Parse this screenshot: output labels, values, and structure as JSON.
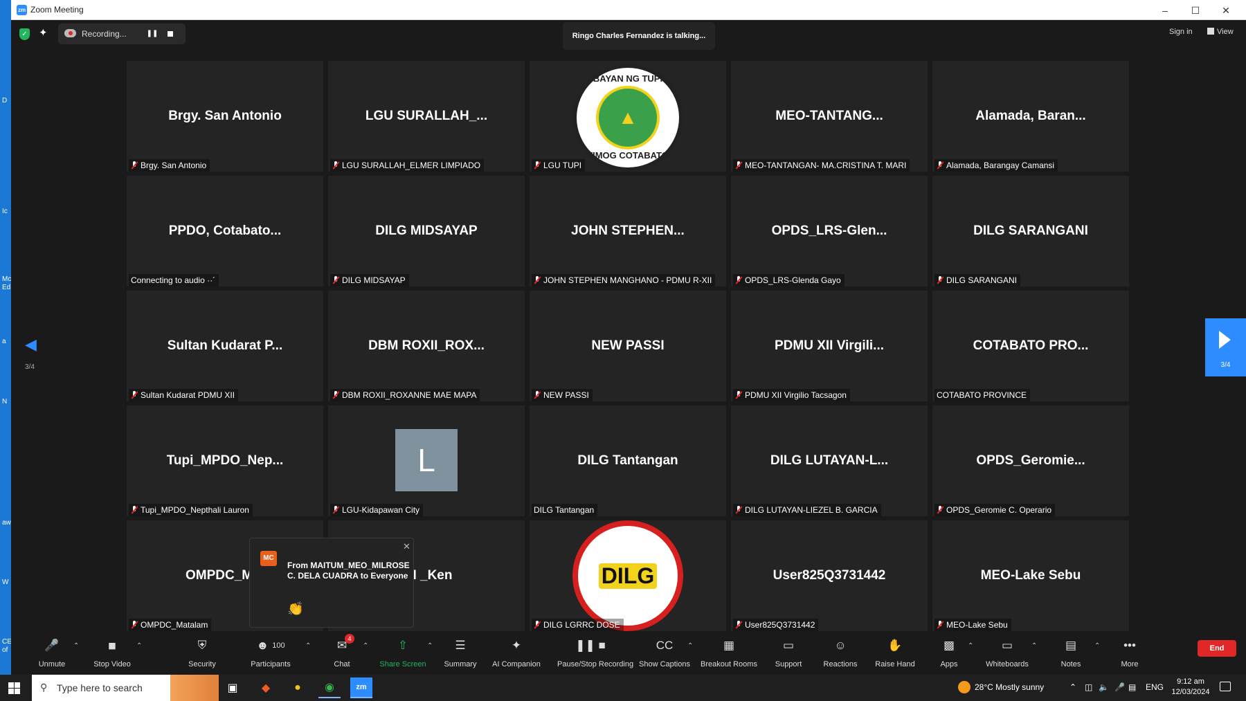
{
  "window": {
    "title": "Zoom Meeting",
    "icon": "zm"
  },
  "desktop_strip": [
    "D",
    "Ic",
    "Mc",
    "Ed",
    "a",
    "N",
    "aw",
    "W",
    "CE",
    "of"
  ],
  "topbar": {
    "recording_label": "Recording...",
    "talking": "Ringo Charles Fernandez is talking...",
    "sign_in": "Sign in",
    "view": "View"
  },
  "nav": {
    "left_page": "3/4",
    "right_page": "3/4"
  },
  "tiles": [
    {
      "big": "Brgy. San Antonio",
      "label": "Brgy. San Antonio",
      "muted": true
    },
    {
      "big": "LGU  SURALLAH_...",
      "label": "LGU SURALLAH_ELMER LIMPIADO",
      "muted": true
    },
    {
      "big": "",
      "label": "LGU TUPI",
      "muted": true,
      "logo": "tupi",
      "logo_top": "BAYAN NG TUPI",
      "logo_bottom": "TIMOG COTABATO"
    },
    {
      "big": "MEO-TANTANG...",
      "label": "MEO-TANTANGAN- MA.CRISTINA T. MARI",
      "muted": true
    },
    {
      "big": "Alamada,  Baran...",
      "label": "Alamada, Barangay Camansi",
      "muted": true
    },
    {
      "big": "PPDO,  Cotabato...",
      "label": "Connecting to audio ··´",
      "muted": false
    },
    {
      "big": "DILG MIDSAYAP",
      "label": "DILG MIDSAYAP",
      "muted": true
    },
    {
      "big": "JOHN  STEPHEN...",
      "label": "JOHN STEPHEN MANGHANO - PDMU  R-XII",
      "muted": true
    },
    {
      "big": "OPDS_LRS-Glen...",
      "label": "OPDS_LRS-Glenda Gayo",
      "muted": true
    },
    {
      "big": "DILG SARANGANI",
      "label": "DILG SARANGANI",
      "muted": true
    },
    {
      "big": "Sultan Kudarat P...",
      "label": "Sultan Kudarat PDMU XII",
      "muted": true
    },
    {
      "big": "DBM  ROXII_ROX...",
      "label": "DBM ROXII_ROXANNE MAE MAPA",
      "muted": true
    },
    {
      "big": "NEW PASSI",
      "label": "NEW PASSI",
      "muted": true
    },
    {
      "big": "PDMU XII Virgili...",
      "label": "PDMU XII Virgilio Tacsagon",
      "muted": true
    },
    {
      "big": "COTABATO  PRO...",
      "label": "COTABATO PROVINCE",
      "muted": false
    },
    {
      "big": "Tupi_MPDO_Nep...",
      "label": "Tupi_MPDO_Nepthali Lauron",
      "muted": true
    },
    {
      "big": "",
      "label": "LGU-Kidapawan City",
      "muted": true,
      "avatar": "L"
    },
    {
      "big": "DILG Tantangan",
      "label": "DILG Tantangan",
      "muted": false
    },
    {
      "big": "DILG  LUTAYAN-L...",
      "label": "DILG LUTAYAN-LIEZEL B. GARCIA",
      "muted": true
    },
    {
      "big": "OPDS_Geromie...",
      "label": "OPDS_Geromie C. Operario",
      "muted": true
    },
    {
      "big": "OMPDC_Mat",
      "label": "OMPDC_Matalam",
      "muted": true
    },
    {
      "big": "XII _Ken",
      "label": "",
      "muted": false
    },
    {
      "big": "",
      "label": "DILG LGRRC DOSE",
      "muted": true,
      "logo": "dilg",
      "logo_word": "DILG"
    },
    {
      "big": "User825Q3731442",
      "label": "User825Q3731442",
      "muted": true
    },
    {
      "big": "MEO-Lake Sebu",
      "label": "MEO-Lake Sebu",
      "muted": true
    }
  ],
  "chat_popup": {
    "initials": "MC",
    "from": "From MAITUM_MEO_MILROSE C. DELA CUADRA to Everyone",
    "close": "✕",
    "emoji": "👏"
  },
  "toolbar": {
    "items": [
      {
        "name": "unmute",
        "label": "Unmute",
        "icon": "mic-off-icon"
      },
      {
        "name": "stop-video",
        "label": "Stop Video",
        "icon": "camera-icon"
      },
      {
        "name": "security",
        "label": "Security",
        "icon": "shield-icon"
      },
      {
        "name": "participants",
        "label": "Participants",
        "icon": "people-icon",
        "count": "100"
      },
      {
        "name": "chat",
        "label": "Chat",
        "icon": "chat-icon",
        "badge": "4"
      },
      {
        "name": "share-screen",
        "label": "Share Screen",
        "icon": "share-icon"
      },
      {
        "name": "summary",
        "label": "Summary",
        "icon": "summary-icon"
      },
      {
        "name": "ai-companion",
        "label": "AI Companion",
        "icon": "sparkle-icon"
      },
      {
        "name": "recording",
        "label": "Pause/Stop Recording",
        "icon": "pause-stop-icon"
      },
      {
        "name": "captions",
        "label": "Show Captions",
        "icon": "cc-icon"
      },
      {
        "name": "breakout",
        "label": "Breakout Rooms",
        "icon": "grid-icon"
      },
      {
        "name": "support",
        "label": "Support",
        "icon": "support-icon"
      },
      {
        "name": "reactions",
        "label": "Reactions",
        "icon": "smile-icon"
      },
      {
        "name": "raise-hand",
        "label": "Raise Hand",
        "icon": "hand-icon"
      },
      {
        "name": "apps",
        "label": "Apps",
        "icon": "apps-icon"
      },
      {
        "name": "whiteboards",
        "label": "Whiteboards",
        "icon": "whiteboard-icon"
      },
      {
        "name": "notes",
        "label": "Notes",
        "icon": "notes-icon"
      },
      {
        "name": "more",
        "label": "More",
        "icon": "more-icon"
      }
    ],
    "end_label": "End",
    "share_color": "#23b45d"
  },
  "taskbar": {
    "search_placeholder": "Type here to search",
    "weather": "28°C  Mostly sunny",
    "lang": "ENG",
    "time": "9:12 am",
    "date": "12/03/2024"
  }
}
